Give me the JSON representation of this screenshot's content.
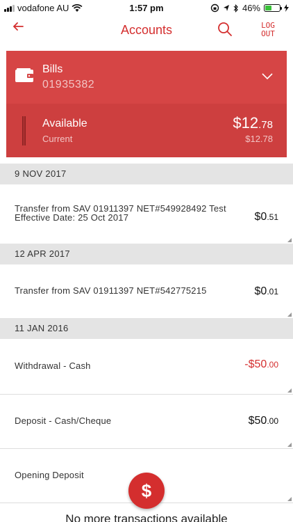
{
  "status_bar": {
    "carrier": "vodafone AU",
    "time": "1:57 pm",
    "battery": "46%",
    "battery_level": 0.46
  },
  "nav": {
    "title": "Accounts",
    "logout_line1": "LOG",
    "logout_line2": "OUT",
    "back_icon": "arrow-left-icon",
    "search_icon": "search-icon"
  },
  "account": {
    "name": "Bills",
    "number": "01935382",
    "available_label": "Available",
    "current_label": "Current",
    "available_dollars": "$12",
    "available_cents": ".78",
    "current_balance": "$12.78"
  },
  "groups": [
    {
      "date": "9 NOV 2017",
      "transactions": [
        {
          "line1": "Transfer from SAV 01911397 NET#549928492 Test",
          "line2": "Effective Date: 25 Oct 2017",
          "dollars": "$0",
          "cents": ".51"
        }
      ]
    },
    {
      "date": "12 APR 2017",
      "transactions": [
        {
          "line1": "Transfer from SAV 01911397 NET#542775215",
          "dollars": "$0",
          "cents": ".01"
        }
      ]
    },
    {
      "date": "11 JAN 2016",
      "transactions": [
        {
          "line1": "Withdrawal - Cash",
          "dollars": "-$50",
          "cents": ".00"
        },
        {
          "line1": "Deposit - Cash/Cheque",
          "dollars": "$50",
          "cents": ".00"
        },
        {
          "line1": "Opening Deposit"
        }
      ]
    }
  ],
  "fab_symbol": "$",
  "footer_text": "No more transactions available",
  "colors": {
    "accent": "#d42e2e",
    "card": "#d64545"
  }
}
